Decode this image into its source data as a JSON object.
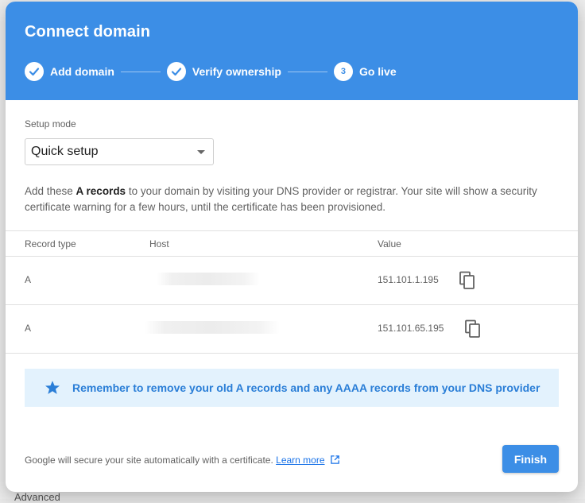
{
  "backdrop": {
    "advanced_label": "Advanced"
  },
  "dialog": {
    "title": "Connect domain",
    "steps": [
      {
        "label": "Add domain",
        "state": "done"
      },
      {
        "label": "Verify ownership",
        "state": "done"
      },
      {
        "label": "Go live",
        "state": "current",
        "number": "3"
      }
    ]
  },
  "setup": {
    "label": "Setup mode",
    "selected": "Quick setup"
  },
  "description": {
    "prefix": "Add these ",
    "bold": "A records",
    "suffix": " to your domain by visiting your DNS provider or registrar. Your site will show a security certificate warning for a few hours, until the certificate has been provisioned."
  },
  "table": {
    "headers": {
      "type": "Record type",
      "host": "Host",
      "value": "Value"
    },
    "rows": [
      {
        "type": "A",
        "value": "151.101.1.195"
      },
      {
        "type": "A",
        "value": "151.101.65.195"
      }
    ]
  },
  "tip": {
    "text": "Remember to remove your old A records and any AAAA records from your DNS provider"
  },
  "footer": {
    "text": "Google will secure your site automatically with a certificate. ",
    "link": "Learn more",
    "finish_label": "Finish"
  },
  "colors": {
    "header_bg": "#3c8ee6",
    "tip_bg": "#e3f2fd",
    "tip_text": "#2a7ed7",
    "accent": "#3c8ee6"
  },
  "icons": {
    "step_done": "check-icon",
    "copy": "copy-icon",
    "tip": "star-icon",
    "external": "external-link-icon"
  }
}
